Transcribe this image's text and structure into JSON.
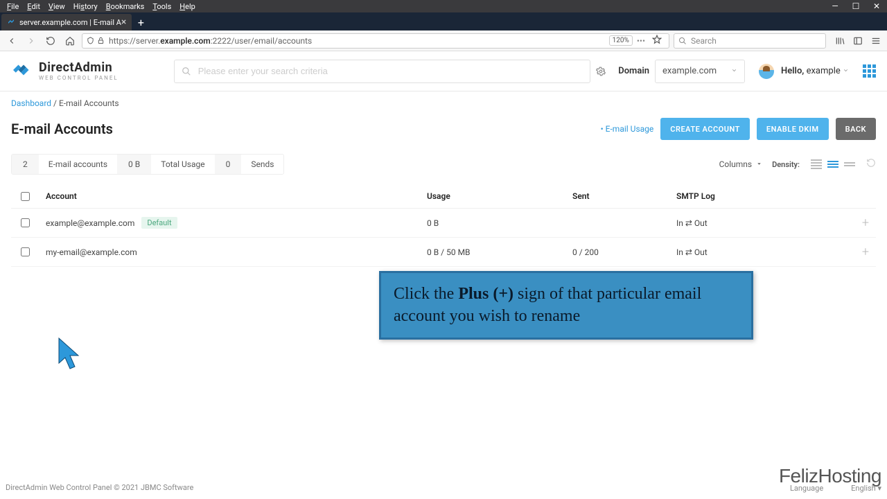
{
  "browser": {
    "menu": [
      "File",
      "Edit",
      "View",
      "History",
      "Bookmarks",
      "Tools",
      "Help"
    ],
    "tab_title": "server.example.com | E-mail A",
    "url_prefix": "https://server.",
    "url_bold": "example.com",
    "url_suffix": ":2222/user/email/accounts",
    "zoom": "120%",
    "search_placeholder": "Search"
  },
  "brand": {
    "name": "DirectAdmin",
    "subtitle": "web control panel"
  },
  "search_placeholder": "Please enter your search criteria",
  "domain": {
    "label": "Domain",
    "value": "example.com"
  },
  "user": {
    "hello": "Hello,",
    "name": "example"
  },
  "crumbs": {
    "root": "Dashboard",
    "sep": "/",
    "current": "E-mail Accounts"
  },
  "page_title": "E-mail Accounts",
  "actions": {
    "usage_link": "E-mail Usage",
    "create": "CREATE ACCOUNT",
    "enable_dkim": "ENABLE DKIM",
    "back": "BACK"
  },
  "stats": {
    "count": "2",
    "count_label": "E-mail accounts",
    "usage": "0 B",
    "usage_label": "Total Usage",
    "sends": "0",
    "sends_label": "Sends"
  },
  "table_controls": {
    "columns": "Columns",
    "density": "Density:"
  },
  "table": {
    "headers": {
      "account": "Account",
      "usage": "Usage",
      "sent": "Sent",
      "smtp": "SMTP Log"
    },
    "rows": [
      {
        "account": "example@example.com",
        "badge": "Default",
        "usage": "0 B",
        "sent": "",
        "smtp": "In ⇄ Out"
      },
      {
        "account": "my-email@example.com",
        "badge": "",
        "usage": "0 B / 50 MB",
        "sent": "0 / 200",
        "smtp": "In ⇄ Out"
      }
    ]
  },
  "callout": {
    "pre": "Click the ",
    "bold": "Plus (+)",
    "post": " sign of that particular email account you wish to rename"
  },
  "footer": {
    "copyright": "DirectAdmin Web Control Panel © 2021 JBMC Software",
    "watermark": "FelizHosting",
    "language_label": "Language",
    "language_value": "English"
  }
}
